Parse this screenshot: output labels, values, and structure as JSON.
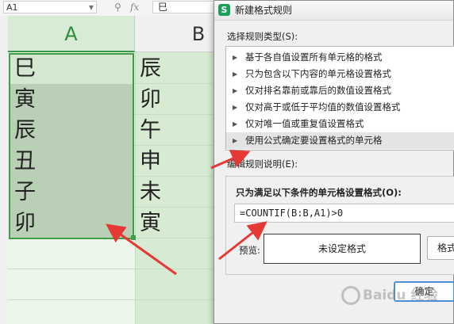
{
  "formula_bar": {
    "name_box": "A1",
    "cell_content": "巳",
    "zoom_icon": "magnifier-icon",
    "function_icon": "fx-icon"
  },
  "sheet": {
    "columns": [
      "A",
      "B"
    ],
    "col_a_values": [
      "巳",
      "寅",
      "辰",
      "丑",
      "子",
      "卯"
    ],
    "col_b_values": [
      "辰",
      "卯",
      "午",
      "申",
      "未",
      "寅"
    ]
  },
  "dialog": {
    "icon_letter": "S",
    "title": "新建格式规则",
    "rule_type_label": "选择规则类型(S):",
    "rule_types": [
      "基于各自值设置所有单元格的格式",
      "只为包含以下内容的单元格设置格式",
      "仅对排名靠前或靠后的数值设置格式",
      "仅对高于或低于平均值的数值设置格式",
      "仅对唯一值或重复值设置格式",
      "使用公式确定要设置格式的单元格"
    ],
    "selected_rule_index": 5,
    "edit_desc_label": "编辑规则说明(E):",
    "condition_label": "只为满足以下条件的单元格设置格式(O):",
    "formula_value": "=COUNTIF(B:B,A1)>0",
    "preview_label": "预览:",
    "preview_text": "未设定格式",
    "format_button": "格式(F)...",
    "ok_button": "确定"
  },
  "colors": {
    "selection_border": "#3f9e48",
    "annotation_arrow": "#e53935",
    "app_icon": "#1aa05a",
    "ok_focus": "#4a90d9"
  },
  "watermark": "Baidu 经验"
}
